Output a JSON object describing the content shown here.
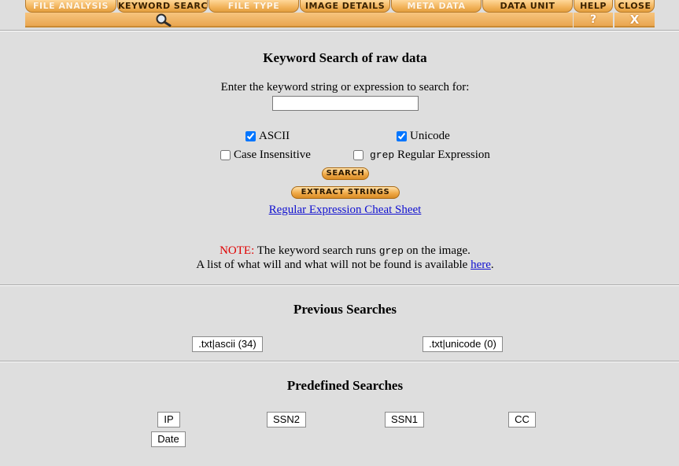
{
  "toolbar": {
    "tabs": [
      {
        "label": "File Analysis"
      },
      {
        "label": "Keyword Search"
      },
      {
        "label": "File Type"
      },
      {
        "label": "Image Details"
      },
      {
        "label": "Meta Data"
      },
      {
        "label": "Data Unit"
      },
      {
        "label": "Help"
      },
      {
        "label": "Close"
      }
    ],
    "help_glyph": "?",
    "close_glyph": "X",
    "search_icon": "magnifying-glass-icon"
  },
  "search": {
    "title": "Keyword Search of raw data",
    "prompt": "Enter the keyword string or expression to search for:",
    "input_value": "",
    "ascii_label": "ASCII",
    "ascii_checked": true,
    "unicode_label": "Unicode",
    "unicode_checked": true,
    "case_label": "Case Insensitive",
    "case_checked": false,
    "grep_word": "grep",
    "regex_label": "Regular Expression",
    "regex_checked": false,
    "search_button": "Search",
    "extract_button": "Extract Strings",
    "cheat_sheet_link": "Regular Expression Cheat Sheet"
  },
  "note": {
    "label": "NOTE:",
    "text_before": "The keyword search runs",
    "grep_word": "grep",
    "text_after": "on the image.",
    "line2": "A list of what will and what will not be found is available",
    "link": "here",
    "period": "."
  },
  "previous": {
    "heading": "Previous Searches",
    "buttons": [
      ".txt|ascii (34)",
      ".txt|unicode (0)"
    ]
  },
  "predefined": {
    "heading": "Predefined Searches",
    "buttons": [
      "IP",
      "SSN2",
      "SSN1",
      "CC",
      "Date"
    ]
  },
  "colors": {
    "background": "#dedede",
    "tab_orange": "#f2b35a",
    "link": "#1010d0",
    "note_red": "#e00000"
  }
}
